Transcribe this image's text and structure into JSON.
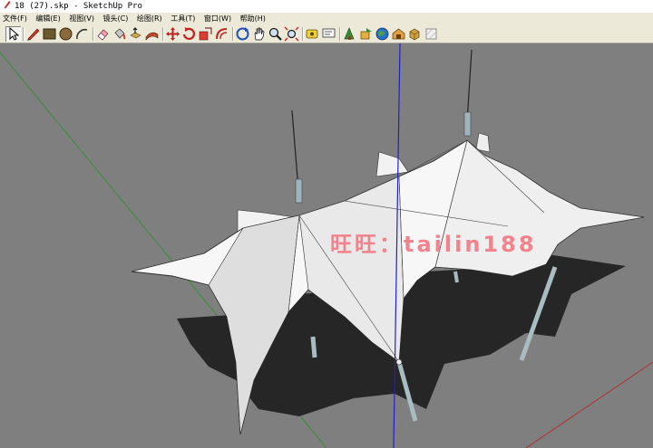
{
  "window": {
    "title": "18 (27).skp - SketchUp Pro"
  },
  "menu": [
    {
      "label": "文件(F)"
    },
    {
      "label": "编辑(E)"
    },
    {
      "label": "视图(V)"
    },
    {
      "label": "镜头(C)"
    },
    {
      "label": "绘图(R)"
    },
    {
      "label": "工具(T)"
    },
    {
      "label": "窗口(W)"
    },
    {
      "label": "帮助(H)"
    }
  ],
  "toolbar": {
    "tools": [
      {
        "icon": "select-arrow-icon",
        "active": true
      },
      {
        "icon": "pencil-line-icon"
      },
      {
        "icon": "rectangle-icon"
      },
      {
        "icon": "circle-icon"
      },
      {
        "icon": "arc-icon"
      },
      {
        "icon": "eraser-icon"
      },
      {
        "icon": "paint-bucket-icon"
      },
      {
        "icon": "push-pull-icon"
      },
      {
        "icon": "follow-me-icon"
      },
      {
        "icon": "move-icon"
      },
      {
        "icon": "rotate-icon"
      },
      {
        "icon": "scale-icon"
      },
      {
        "icon": "offset-icon"
      },
      {
        "icon": "orbit-icon"
      },
      {
        "icon": "pan-hand-icon"
      },
      {
        "icon": "zoom-icon"
      },
      {
        "icon": "zoom-extents-icon"
      },
      {
        "icon": "measure-tape-icon"
      },
      {
        "icon": "text-label-icon"
      },
      {
        "icon": "get-models-icon"
      },
      {
        "icon": "share-model-icon"
      },
      {
        "icon": "geo-location-icon"
      },
      {
        "icon": "warehouse-icon"
      },
      {
        "icon": "components-icon"
      },
      {
        "icon": "materials-icon"
      }
    ]
  },
  "viewport": {
    "watermark": "旺旺：tailin188",
    "colors": {
      "background": "#7f7f7f",
      "green_axis": "#3c8c3c",
      "blue_axis": "#2020c8",
      "red_axis": "#b03030",
      "membrane": "#ffffff",
      "shadow": "#2a2a2a",
      "watermark": "#f2828c"
    }
  }
}
